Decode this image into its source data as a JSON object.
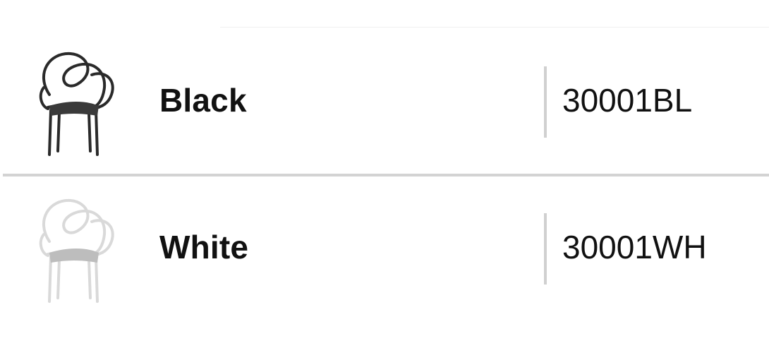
{
  "variants": [
    {
      "color_name": "Black",
      "sku": "30001BL",
      "icon": "black-loop-chair-icon",
      "chair_color": "#2a2a2a",
      "seat_color": "#3a3a3a"
    },
    {
      "color_name": "White",
      "sku": "30001WH",
      "icon": "white-loop-chair-icon",
      "chair_color": "#d9d9d9",
      "seat_color": "#bdbdbd"
    }
  ]
}
